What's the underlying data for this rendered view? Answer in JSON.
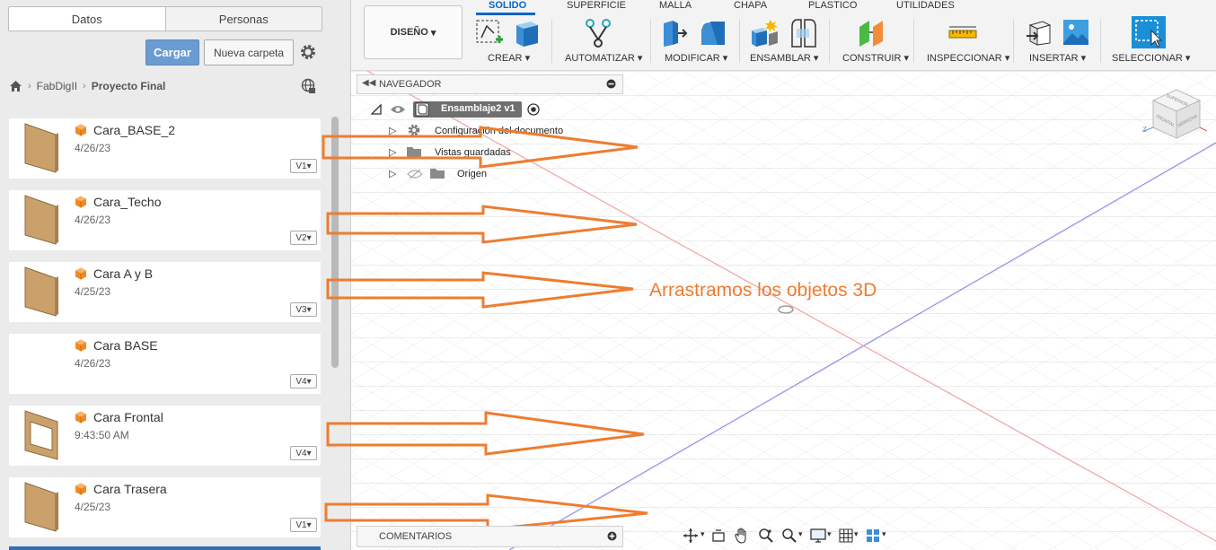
{
  "left_panel": {
    "tabs": [
      "Datos",
      "Personas"
    ],
    "cargar_label": "Cargar",
    "nueva_carpeta_label": "Nueva carpeta",
    "breadcrumb": [
      "FabDigII",
      "Proyecto Final"
    ],
    "items": [
      {
        "name": "Cara_BASE_2",
        "date": "4/26/23",
        "version": "V1"
      },
      {
        "name": "Cara_Techo",
        "date": "4/26/23",
        "version": "V2"
      },
      {
        "name": "Cara A y B",
        "date": "4/25/23",
        "version": "V3"
      },
      {
        "name": "Cara BASE",
        "date": "4/26/23",
        "version": "V4"
      },
      {
        "name": "Cara Frontal",
        "date": "9:43:50 AM",
        "version": "V4"
      },
      {
        "name": "Cara Trasera",
        "date": "4/25/23",
        "version": "V1"
      }
    ]
  },
  "toolbar": {
    "workspace_label": "DISEÑO",
    "ribbon_tabs": [
      "SOLIDO",
      "SUPERFICIE",
      "MALLA",
      "CHAPA",
      "PLASTICO",
      "UTILIDADES"
    ],
    "active_tab": "SOLIDO",
    "groups": [
      "CREAR",
      "AUTOMATIZAR",
      "MODIFICAR",
      "ENSAMBLAR",
      "CONSTRUIR",
      "INSPECCIONAR",
      "INSERTAR",
      "SELECCIONAR"
    ]
  },
  "navigator": {
    "title": "NAVEGADOR",
    "root": "Ensamblaje2 v1",
    "nodes": [
      "Configuración del documento",
      "Vistas guardadas",
      "Origen"
    ]
  },
  "comments": {
    "title": "COMENTARIOS"
  },
  "viewcube": {
    "faces": [
      "SUPERIOR",
      "FRONTAL",
      "DERECHA"
    ]
  },
  "annotation": "Arrastramos los objetos 3D",
  "colors": {
    "accent": "#0a66c2",
    "annotation": "#ed7d31",
    "cube_icon": "#f08a24"
  }
}
